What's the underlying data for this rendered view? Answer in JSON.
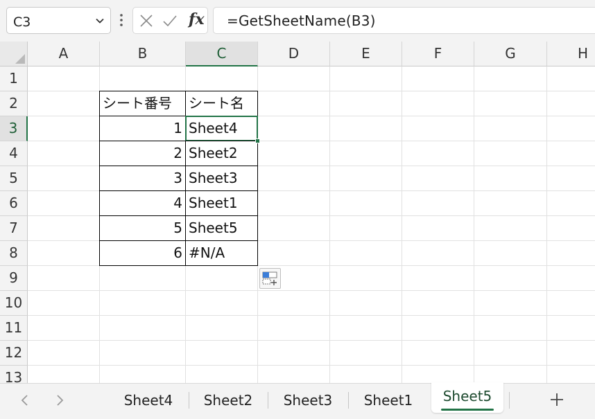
{
  "formula_bar": {
    "name_box": "C3",
    "formula": "=GetSheetName(B3)",
    "fx_label": "fx",
    "icons": [
      "chevron-down-icon",
      "vertical-dots-icon",
      "cancel-x-icon",
      "enter-check-icon",
      "function-icon"
    ]
  },
  "grid": {
    "columns": [
      "A",
      "B",
      "C",
      "D",
      "E",
      "F",
      "G",
      "H"
    ],
    "rows": [
      "1",
      "2",
      "3",
      "4",
      "5",
      "6",
      "7",
      "8",
      "9",
      "10",
      "11",
      "12",
      "13"
    ],
    "selected_column": "C",
    "selected_row": "3",
    "table": {
      "headers": [
        "シート番号",
        "シート名"
      ],
      "rows": [
        {
          "number": "1",
          "name": "Sheet4"
        },
        {
          "number": "2",
          "name": "Sheet2"
        },
        {
          "number": "3",
          "name": "Sheet3"
        },
        {
          "number": "4",
          "name": "Sheet1"
        },
        {
          "number": "5",
          "name": "Sheet5"
        },
        {
          "number": "6",
          "name": "#N/A"
        }
      ]
    }
  },
  "sheet_tabs": {
    "tabs": [
      "Sheet4",
      "Sheet2",
      "Sheet3",
      "Sheet1",
      "Sheet5"
    ],
    "active": "Sheet5",
    "add_label": "+"
  },
  "colors": {
    "accent": "#217346",
    "header_bg": "#f3f3f3",
    "gridline": "#e1e1e1"
  }
}
